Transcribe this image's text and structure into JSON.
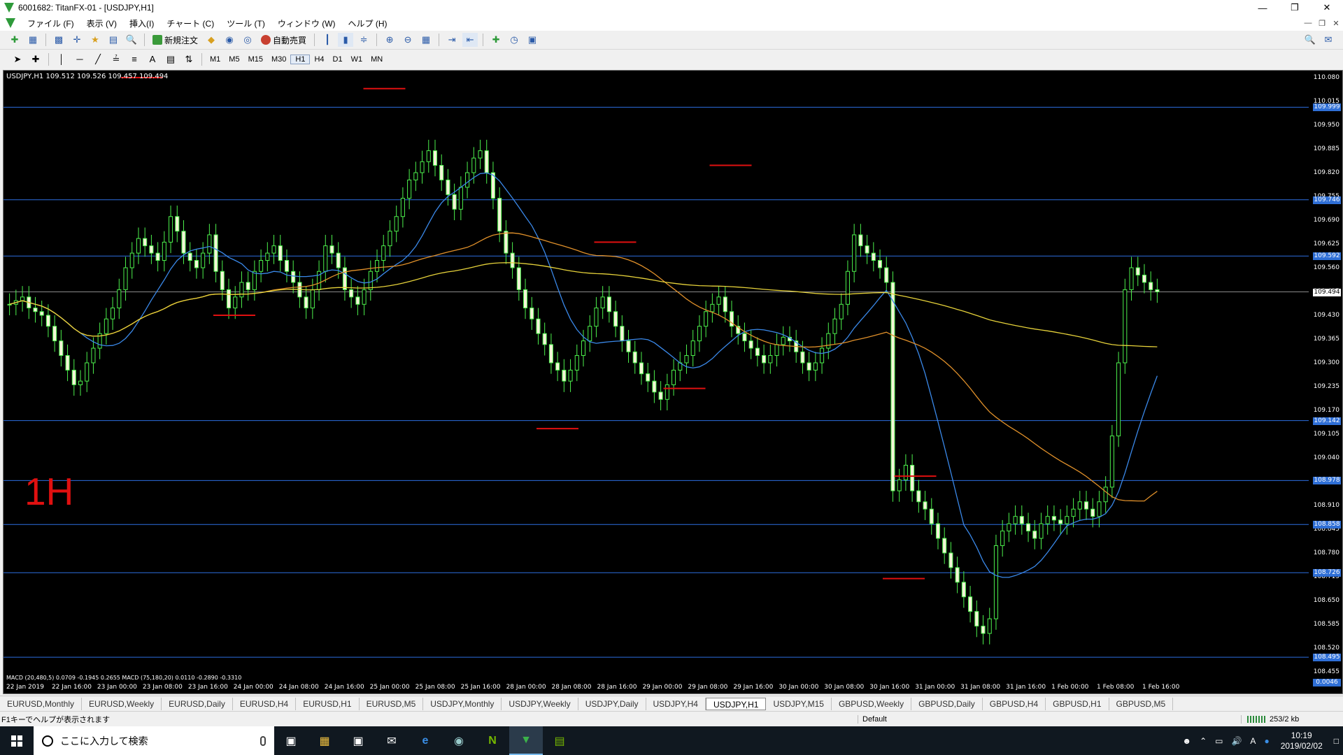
{
  "window": {
    "title": "6001682: TitanFX-01 - [USDJPY,H1]"
  },
  "menu": [
    "ファイル (F)",
    "表示 (V)",
    "挿入(I)",
    "チャート (C)",
    "ツール (T)",
    "ウィンドウ (W)",
    "ヘルプ (H)"
  ],
  "toolbar": {
    "new_order": "新規注文",
    "auto_trade": "自動売買"
  },
  "timeframes": [
    "M1",
    "M5",
    "M15",
    "M30",
    "H1",
    "H4",
    "D1",
    "W1",
    "MN"
  ],
  "active_timeframe": "H1",
  "chart": {
    "header": "USDJPY,H1  109.512 109.526 109.457 109.494",
    "timeframe_label": "1H",
    "macd_text": "MACD (20,480,5) 0.0709 -0.1945 0.2655   MACD (75,180,20) 0.0110 -0.2890 -0.3310",
    "current_price": "109.494",
    "price_ticks": [
      "110.080",
      "110.015",
      "109.950",
      "109.885",
      "109.820",
      "109.755",
      "109.690",
      "109.625",
      "109.560",
      "109.495",
      "109.430",
      "109.365",
      "109.300",
      "109.235",
      "109.170",
      "109.105",
      "109.040",
      "108.975",
      "108.910",
      "108.845",
      "108.780",
      "108.715",
      "108.650",
      "108.585",
      "108.520",
      "108.455"
    ],
    "horizontal_levels": [
      "109.999",
      "109.746",
      "109.592",
      "109.142",
      "108.978",
      "108.858",
      "108.726",
      "108.495"
    ],
    "macd_value": "0.0046",
    "time_labels": [
      "22 Jan 2019",
      "22 Jan 16:00",
      "23 Jan 00:00",
      "23 Jan 08:00",
      "23 Jan 16:00",
      "24 Jan 00:00",
      "24 Jan 08:00",
      "24 Jan 16:00",
      "25 Jan 00:00",
      "25 Jan 08:00",
      "25 Jan 16:00",
      "28 Jan 00:00",
      "28 Jan 08:00",
      "28 Jan 16:00",
      "29 Jan 00:00",
      "29 Jan 08:00",
      "29 Jan 16:00",
      "30 Jan 00:00",
      "30 Jan 08:00",
      "30 Jan 16:00",
      "31 Jan 00:00",
      "31 Jan 08:00",
      "31 Jan 16:00",
      "1 Feb 00:00",
      "1 Feb 08:00",
      "1 Feb 16:00"
    ],
    "colors": {
      "bull": "#4cf04c",
      "bear": "#f4f4d8",
      "ma_fast": "#3a88e8",
      "ma_mid": "#e0902a",
      "ma_slow": "#e6d23a",
      "hline": "#2d6ee0",
      "marker": "#e01010"
    }
  },
  "chart_data": {
    "type": "candlestick",
    "symbol": "USDJPY",
    "timeframe": "H1",
    "ylim": [
      108.455,
      110.08
    ],
    "closes": [
      109.46,
      109.47,
      109.48,
      109.45,
      109.44,
      109.43,
      109.4,
      109.36,
      109.32,
      109.28,
      109.24,
      109.25,
      109.3,
      109.34,
      109.38,
      109.42,
      109.45,
      109.5,
      109.56,
      109.6,
      109.64,
      109.62,
      109.6,
      109.58,
      109.63,
      109.7,
      109.66,
      109.6,
      109.58,
      109.56,
      109.6,
      109.65,
      109.55,
      109.5,
      109.45,
      109.48,
      109.52,
      109.5,
      109.55,
      109.58,
      109.6,
      109.62,
      109.58,
      109.55,
      109.52,
      109.48,
      109.45,
      109.5,
      109.55,
      109.62,
      109.6,
      109.56,
      109.5,
      109.48,
      109.46,
      109.5,
      109.55,
      109.58,
      109.62,
      109.66,
      109.7,
      109.75,
      109.8,
      109.82,
      109.85,
      109.88,
      109.84,
      109.8,
      109.76,
      109.72,
      109.78,
      109.82,
      109.86,
      109.88,
      109.82,
      109.75,
      109.66,
      109.6,
      109.56,
      109.5,
      109.45,
      109.42,
      109.38,
      109.35,
      109.3,
      109.28,
      109.25,
      109.28,
      109.32,
      109.36,
      109.4,
      109.45,
      109.48,
      109.44,
      109.4,
      109.36,
      109.33,
      109.3,
      109.27,
      109.25,
      109.22,
      109.2,
      109.24,
      109.28,
      109.3,
      109.32,
      109.36,
      109.4,
      109.44,
      109.46,
      109.48,
      109.44,
      109.4,
      109.38,
      109.36,
      109.34,
      109.32,
      109.3,
      109.32,
      109.35,
      109.37,
      109.36,
      109.33,
      109.3,
      109.28,
      109.3,
      109.34,
      109.38,
      109.42,
      109.46,
      109.55,
      109.65,
      109.62,
      109.6,
      109.58,
      109.56,
      109.52,
      108.95,
      108.98,
      109.02,
      108.95,
      108.92,
      108.9,
      108.86,
      108.82,
      108.78,
      108.74,
      108.7,
      108.66,
      108.62,
      108.58,
      108.56,
      108.6,
      108.8,
      108.84,
      108.86,
      108.88,
      108.86,
      108.84,
      108.82,
      108.86,
      108.88,
      108.87,
      108.86,
      108.88,
      108.9,
      108.92,
      108.9,
      108.88,
      108.92,
      108.96,
      109.1,
      109.3,
      109.5,
      109.56,
      109.54,
      109.52,
      109.5,
      109.494
    ]
  }
}
